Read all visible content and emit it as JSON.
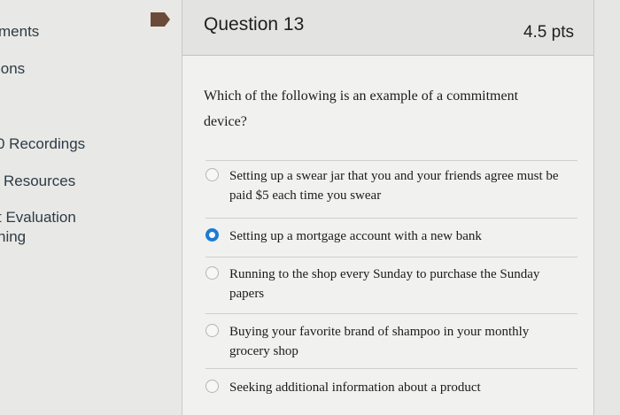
{
  "sidebar": {
    "items": [
      {
        "label": "ments"
      },
      {
        "label": "ions"
      },
      {
        "label": "0 Recordings"
      },
      {
        "label": "Resources"
      },
      {
        "label": "t Evaluation"
      },
      {
        "label": "hing"
      }
    ]
  },
  "question": {
    "title": "Question 13",
    "points": "4.5 pts",
    "text": "Which of the following is an example of a commitment device?",
    "answers": [
      {
        "label": "Setting up a swear jar that you and your friends agree must be paid $5 each time you swear",
        "selected": false
      },
      {
        "label": "Setting up a mortgage account with a new bank",
        "selected": true
      },
      {
        "label": "Running to the shop every Sunday to purchase the Sunday papers",
        "selected": false
      },
      {
        "label": "Buying your favorite brand of shampoo in your monthly grocery shop",
        "selected": false
      },
      {
        "label": "Seeking additional information about a product",
        "selected": false
      }
    ]
  },
  "colors": {
    "accent": "#1d7bd6",
    "flag": "#6b4a3a"
  }
}
